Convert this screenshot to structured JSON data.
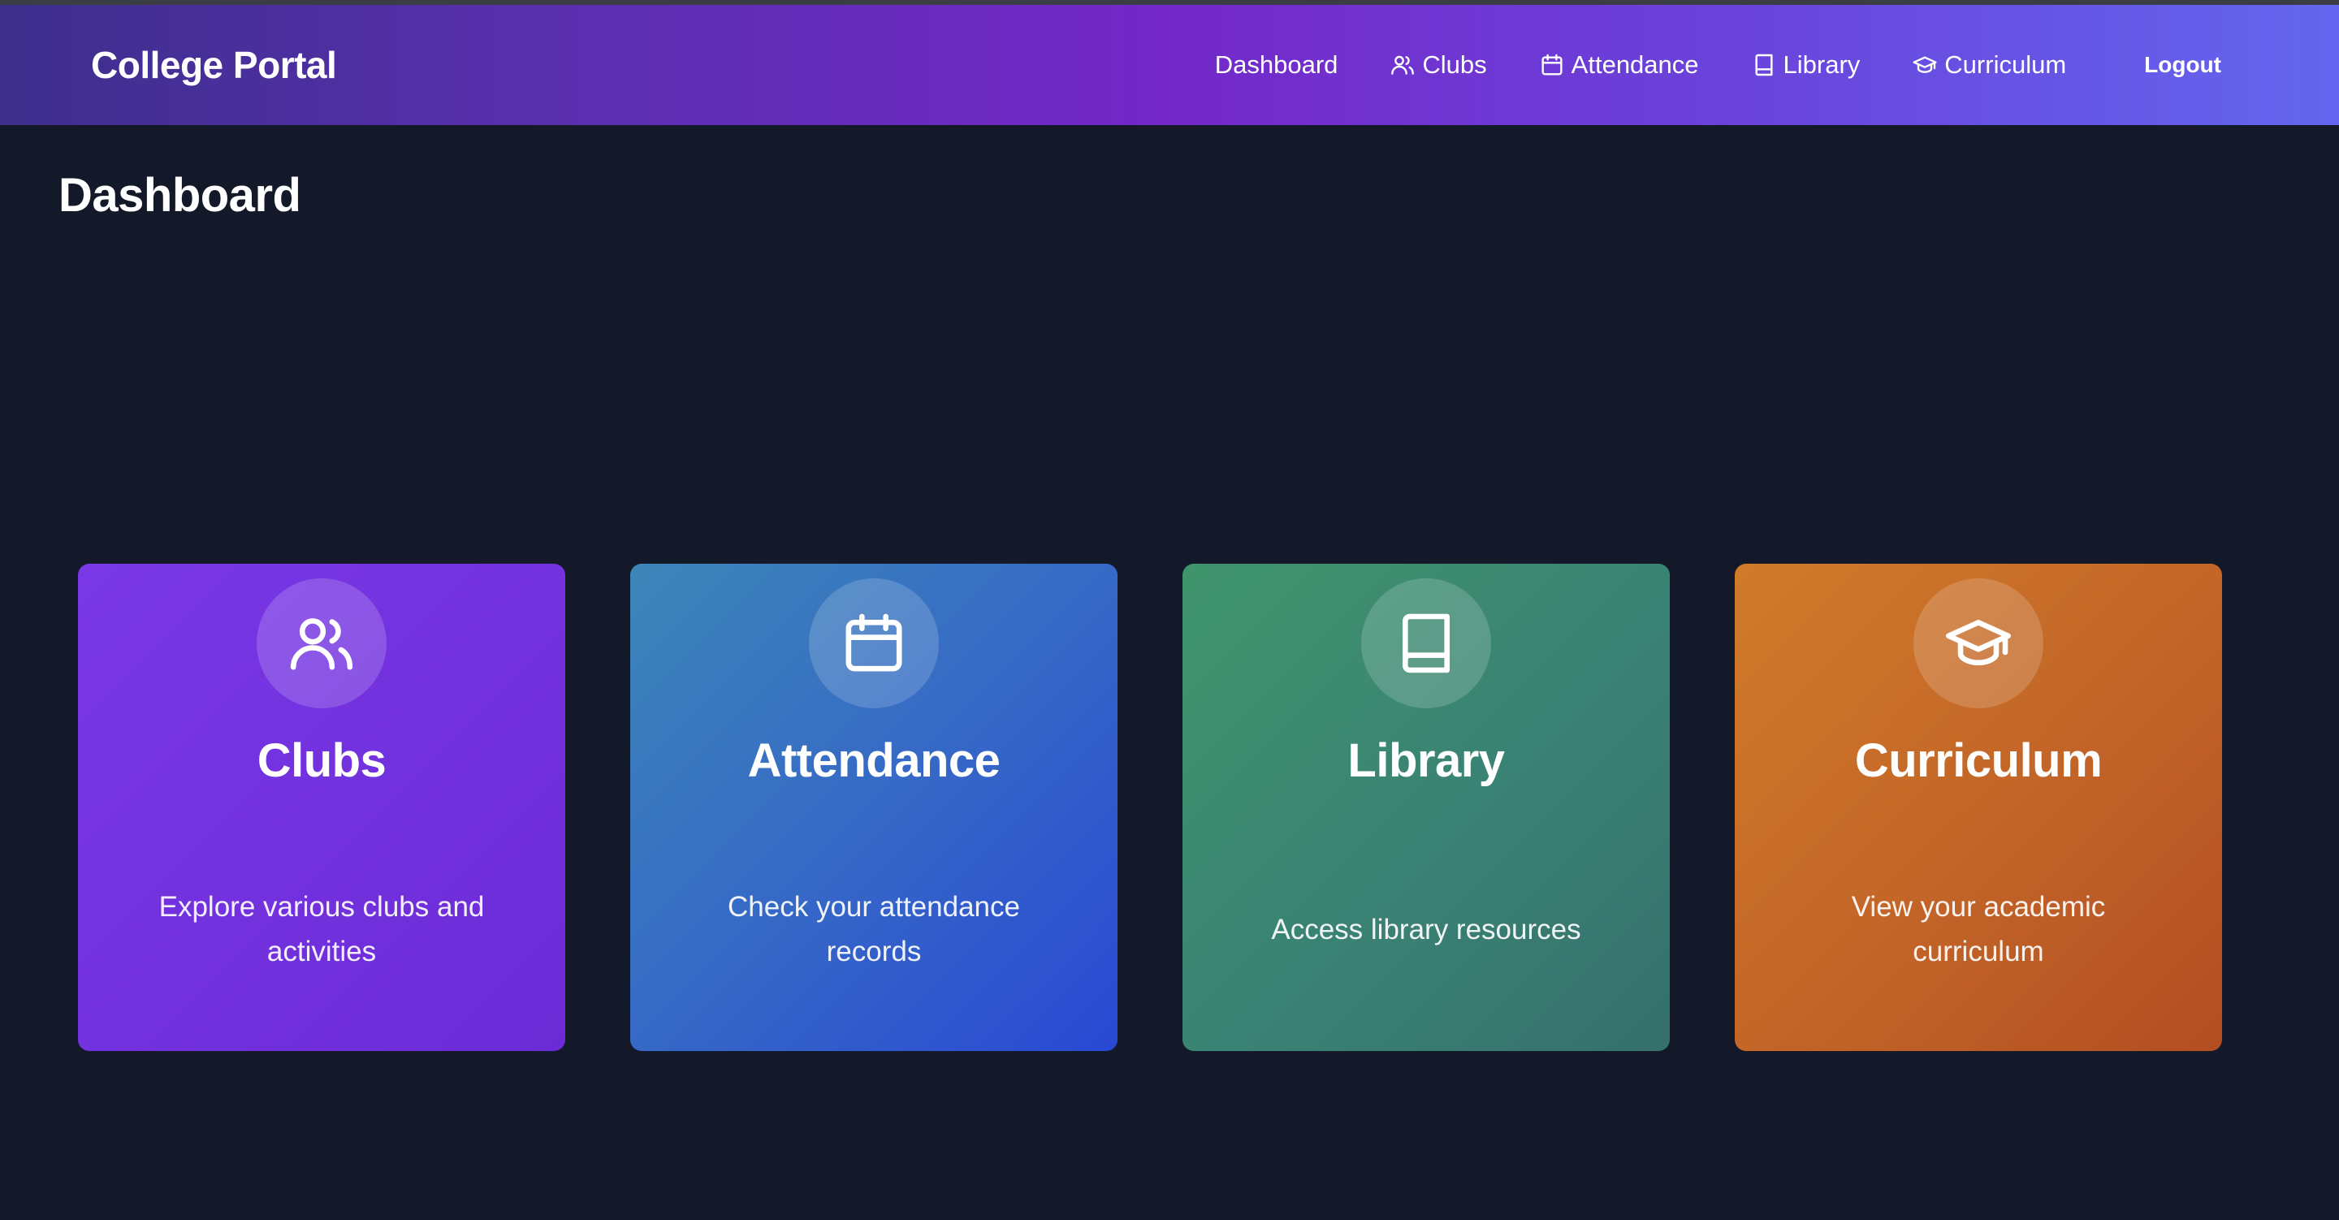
{
  "navbar": {
    "brand": "College Portal",
    "links": [
      {
        "label": "Dashboard",
        "icon": ""
      },
      {
        "label": "Clubs",
        "icon": "users-icon"
      },
      {
        "label": "Attendance",
        "icon": "calendar-icon"
      },
      {
        "label": "Library",
        "icon": "book-icon"
      },
      {
        "label": "Curriculum",
        "icon": "graduation-cap-icon"
      }
    ],
    "logout_label": "Logout"
  },
  "page": {
    "title": "Dashboard"
  },
  "cards": [
    {
      "title": "Clubs",
      "description": "Explore various clubs and activities",
      "icon": "users-icon",
      "color": "#7138e0"
    },
    {
      "title": "Attendance",
      "description": "Check your attendance records",
      "icon": "calendar-icon",
      "color": "#3467c6"
    },
    {
      "title": "Library",
      "description": "Access library resources",
      "icon": "book-icon",
      "color": "#3b8470"
    },
    {
      "title": "Curriculum",
      "description": "View your academic curriculum",
      "icon": "graduation-cap-icon",
      "color": "#c46628"
    }
  ],
  "colors": {
    "background": "#131928",
    "nav_gradient_start": "#3d2f8c",
    "nav_gradient_mid": "#7428c9",
    "nav_gradient_end": "#6366ee"
  }
}
